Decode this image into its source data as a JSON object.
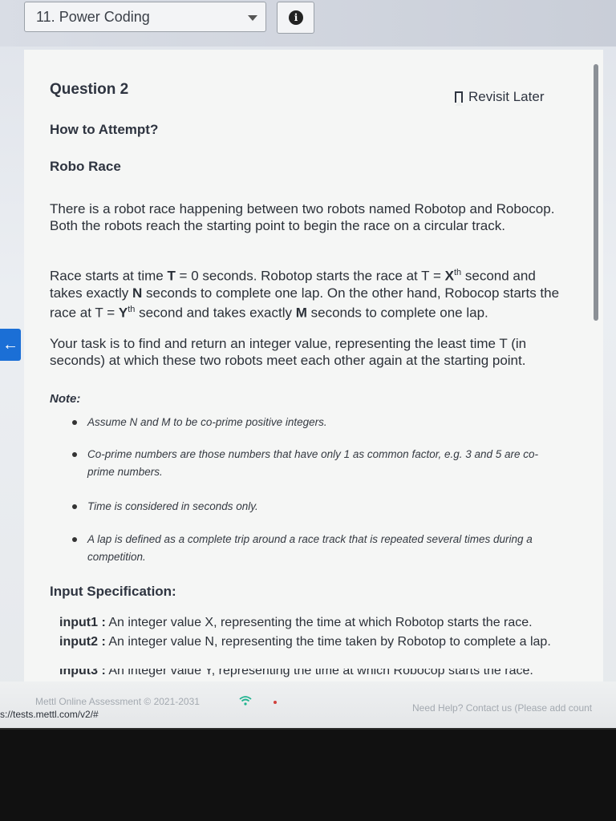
{
  "header": {
    "section_select_value": "11. Power Coding",
    "info_icon": "i"
  },
  "question": {
    "title": "Question 2",
    "revisit_label": "Revisit Later",
    "how_to": "How to Attempt?",
    "problem_title": "Robo Race",
    "paragraphs": [
      "There is a robot race happening between two robots named Robotop and Robocop. Both the robots reach the starting point to begin the race on a circular track.",
      "Your task is to find and return an integer value, representing the least time T (in seconds) at which these two robots meet each other again at the starting point."
    ],
    "para2_parts": {
      "a": "Race starts at time ",
      "T": "T",
      "b": " = 0 seconds. Robotop starts the race at T = ",
      "X": "X",
      "th1": "th",
      "c": " second and takes exactly ",
      "N": "N",
      "d": " seconds to complete one lap. On the other hand, Robocop starts the race at T = ",
      "Y": "Y",
      "th2": "th",
      "e": " second and takes exactly ",
      "M": "M",
      "f": " seconds to complete one lap."
    },
    "note_label": "Note:",
    "notes": [
      "Assume N and M to be co-prime positive integers.",
      "Co-prime numbers are those numbers that have only 1 as common factor, e.g. 3 and 5 are co-prime numbers.",
      "Time is considered in seconds only.",
      "A lap is defined as a complete trip around a race track that is repeated several times during a competition."
    ],
    "input_spec_label": "Input Specification:",
    "inputs": [
      {
        "name": "input1 :",
        "desc": " An integer value X, representing the time at which Robotop starts the race."
      },
      {
        "name": "input2 :",
        "desc": " An integer value N, representing the time taken by Robotop to complete a lap."
      },
      {
        "name": "input3 :",
        "desc": " An integer value Y, representing the time at which Robocop starts the race."
      }
    ]
  },
  "footer": {
    "copyright": "Mettl Online Assessment © 2021-2031",
    "help": "Need Help? Contact us (Please add count",
    "url": "s://tests.mettl.com/v2/#"
  },
  "colors": {
    "accent": "#1b6fd6",
    "status_dot": "#d0413c"
  },
  "icons": {
    "section_caret": "chevron-down-icon",
    "info": "info-icon",
    "bookmark": "bookmark-icon",
    "back": "arrow-left-icon",
    "wifi": "wifi-icon"
  }
}
